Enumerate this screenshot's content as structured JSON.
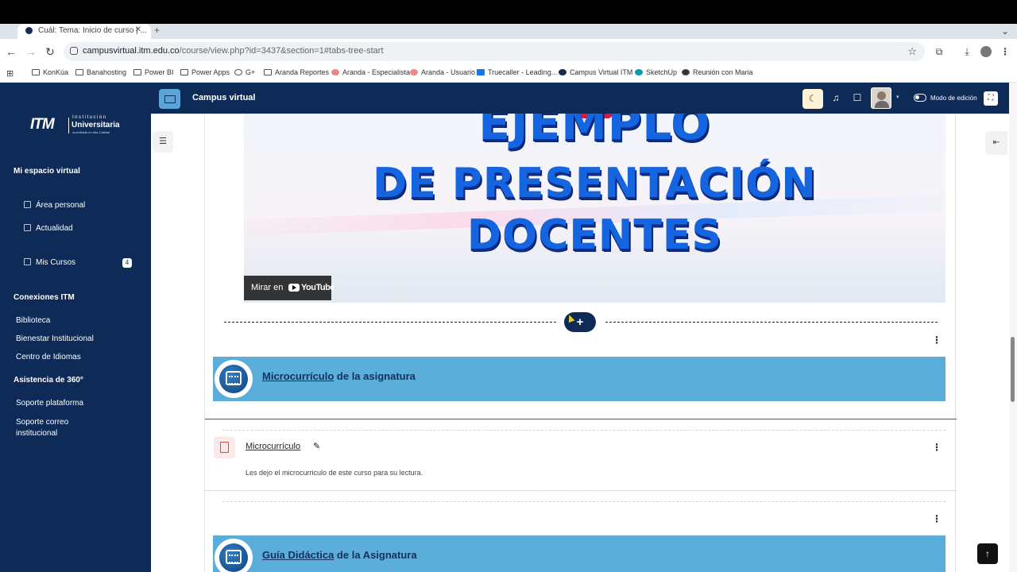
{
  "browser": {
    "tab_title": "Cuál: Tema: Inicio de curso | ...",
    "url_host": "campusvirtual.itm.edu.co",
    "url_path": "/course/view.php?id=3437&section=1#tabs-tree-start",
    "bookmarks": [
      {
        "label": "KonKúa",
        "icon": "folder-icon"
      },
      {
        "label": "Banahosting",
        "icon": "folder-icon"
      },
      {
        "label": "Power BI",
        "icon": "folder-icon"
      },
      {
        "label": "Power Apps",
        "icon": "folder-icon"
      },
      {
        "label": "G+",
        "icon": "google-icon"
      },
      {
        "label": "Aranda Reportes",
        "icon": "chart-icon"
      },
      {
        "label": "Aranda - Especialista",
        "icon": "aranda-icon"
      },
      {
        "label": "Aranda - Usuario",
        "icon": "aranda-icon"
      },
      {
        "label": "Truecaller - Leading...",
        "icon": "truecaller-icon"
      },
      {
        "label": "Campus Virtual ITM",
        "icon": "itm-icon"
      },
      {
        "label": "SketchUp",
        "icon": "sketchup-icon"
      },
      {
        "label": "Reunión con Maria",
        "icon": "globe-icon"
      }
    ]
  },
  "sidebar": {
    "logo": {
      "mark": "ITM",
      "line1": "Institución",
      "line2": "Universitaria",
      "line3": "Acreditada en Alta Calidad"
    },
    "section1_title": "Mi espacio virtual",
    "items": [
      {
        "label": "Área personal",
        "icon": "dashboard-icon"
      },
      {
        "label": "Actualidad",
        "icon": "calendar-icon"
      },
      {
        "label": "Mis Cursos",
        "icon": "courses-icon",
        "badge": "4"
      }
    ],
    "section2_title": "Conexiones ITM",
    "links2": [
      "Biblioteca",
      "Bienestar Institucional",
      "Centro de Idiomas"
    ],
    "section3_title": "Asistencia de 360°",
    "links3": [
      "Soporte plataforma",
      "Soporte correo institucional"
    ]
  },
  "topbar": {
    "site_name": "Campus virtual",
    "edit_mode_label": "Modo de edición"
  },
  "video": {
    "line1": "EJEMPLO",
    "line2": "DE PRESENTACIÓN",
    "line3": "DOCENTES",
    "watch_on": "Mirar en",
    "youtube": "YouTube"
  },
  "add_button_label": "+",
  "sections": [
    {
      "title_link": "Microcurrículo",
      "title_rest": " de la asignatura"
    },
    {
      "title_link": "Guía Didáctica",
      "title_rest": " de la Asignatura"
    }
  ],
  "activity": {
    "name": "Microcurrículo",
    "description": "Les dejo el microcurriculo de este curso para su lectura."
  },
  "colors": {
    "sidebar_bg": "#0e2a56",
    "banner": "#5aaed9",
    "accent_blue": "#1565e0"
  }
}
